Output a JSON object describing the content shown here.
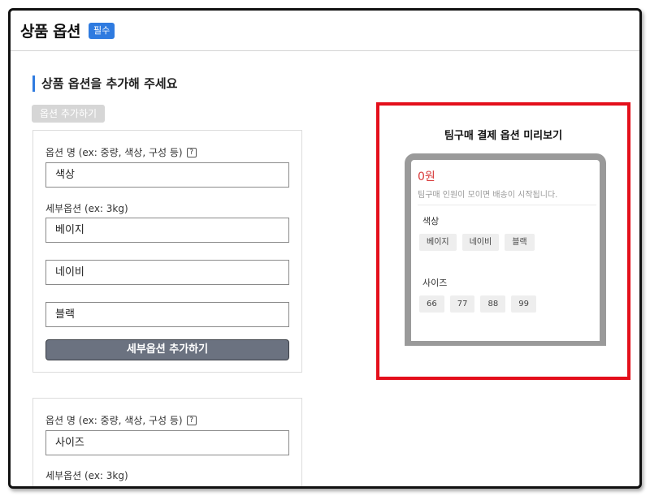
{
  "header": {
    "title": "상품 옵션",
    "badge": "필수"
  },
  "section": {
    "title": "상품 옵션을 추가해 주세요",
    "add_option_label": "옵션 추가하기"
  },
  "option_cards": [
    {
      "name_label": "옵션 명 (ex: 중량, 색상, 구성 등)",
      "name_value": "색상",
      "sub_label": "세부옵션 (ex: 3kg)",
      "sub_values": [
        "베이지",
        "네이비",
        "블랙"
      ],
      "add_sub_label": "세부옵션 추가하기"
    },
    {
      "name_label": "옵션 명 (ex: 중량, 색상, 구성 등)",
      "name_value": "사이즈",
      "sub_label": "세부옵션 (ex: 3kg)"
    }
  ],
  "help_icon_glyph": "?",
  "preview": {
    "title": "팀구매 결제 옵션 미리보기",
    "price": "0원",
    "delivery_note": "팀구매 인원이 모이면 배송이 시작됩니다.",
    "groups": [
      {
        "label": "색상",
        "chips": [
          "베이지",
          "네이비",
          "블랙"
        ]
      },
      {
        "label": "사이즈",
        "chips": [
          "66",
          "77",
          "88",
          "99"
        ]
      }
    ]
  },
  "colors": {
    "accent": "#2f7be0",
    "highlight_border": "#e40f1b",
    "price": "#d83a3a"
  }
}
